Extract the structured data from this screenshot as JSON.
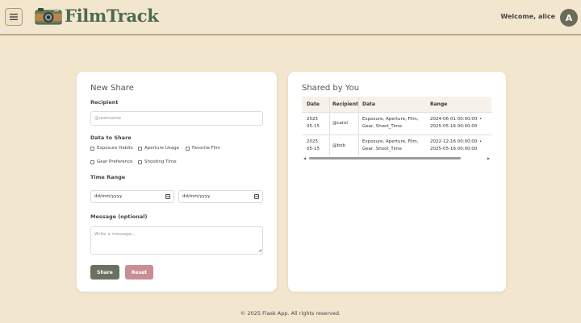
{
  "header": {
    "brand": "FilmTrack",
    "welcome": "Welcome, alice",
    "avatar_initial": "A"
  },
  "new_share": {
    "title": "New Share",
    "recipient_label": "Recipient",
    "recipient_placeholder": "@username",
    "data_label": "Data to Share",
    "options": [
      "Exposure Habits",
      "Aperture Usage",
      "Favorite Film",
      "Gear Preference",
      "Shooting Time"
    ],
    "time_range_label": "Time Range",
    "date_from_placeholder": "dd/mm/yyyy",
    "date_to_placeholder": "dd/mm/yyyy",
    "message_label": "Message (optional)",
    "message_placeholder": "Write a message...",
    "share_button": "Share",
    "reset_button": "Reset"
  },
  "shared_by_you": {
    "title": "Shared by You",
    "columns": [
      "Date",
      "Recipient",
      "Data",
      "Range"
    ],
    "rows": [
      {
        "date_line1": "2025",
        "date_line2": "05-15",
        "recipient": "@carol",
        "data_line1": "Exposure, Aperture, Film,",
        "data_line2": "Gear, Shoot_Time",
        "range_line1": "2024-06-01 00:00:00",
        "range_line2": "2025-05-16 00:00:00"
      },
      {
        "date_line1": "2025",
        "date_line2": "05-15",
        "recipient": "@bob",
        "data_line1": "Exposure, Aperture, Film,",
        "data_line2": "Gear, Shoot_Time",
        "range_line1": "2022-12-16 00:00:00",
        "range_line2": "2025-05-16 00:00:00"
      }
    ]
  },
  "footer": "© 2025 Flask App. All rights reserved."
}
